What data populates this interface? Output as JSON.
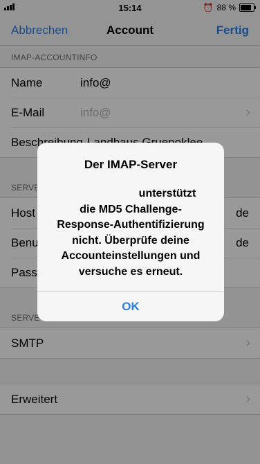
{
  "status_bar": {
    "time": "15:14",
    "battery_text": "88 %",
    "alarm_icon": "alarm-clock-icon",
    "signal_icon": "cellular-signal-icon",
    "battery_icon": "battery-icon",
    "battery_level": 0.88
  },
  "nav": {
    "cancel_label": "Abbrechen",
    "title": "Account",
    "done_label": "Fertig"
  },
  "imap_section": {
    "header": "IMAP-ACCOUNTINFO",
    "rows": [
      {
        "label": "Name",
        "value": "info@"
      },
      {
        "label": "E-Mail",
        "value": "info@"
      },
      {
        "label": "Beschreibung",
        "value": "Landhaus Gruenoklee"
      }
    ]
  },
  "incoming_section": {
    "header": "SERVE",
    "rows": [
      {
        "label": "Host",
        "value": "de"
      },
      {
        "label": "Benu",
        "value": "de"
      },
      {
        "label": "Passw",
        "value": ""
      }
    ]
  },
  "outgoing_section": {
    "header": "SERVE",
    "smtp_label": "SMTP"
  },
  "advanced": {
    "label": "Erweitert"
  },
  "alert": {
    "title": "Der IMAP-Server",
    "message_lines": [
      "unterstützt",
      "die MD5 Challenge-",
      "Response-Authentifizierung",
      "nicht. Überprüfe deine",
      "Accounteinstellungen und",
      "versuche es erneut."
    ],
    "ok_label": "OK"
  },
  "colors": {
    "accent": "#2f7de1",
    "background": "#f5f5f5",
    "overlay": "rgba(0,0,0,0.40)"
  }
}
